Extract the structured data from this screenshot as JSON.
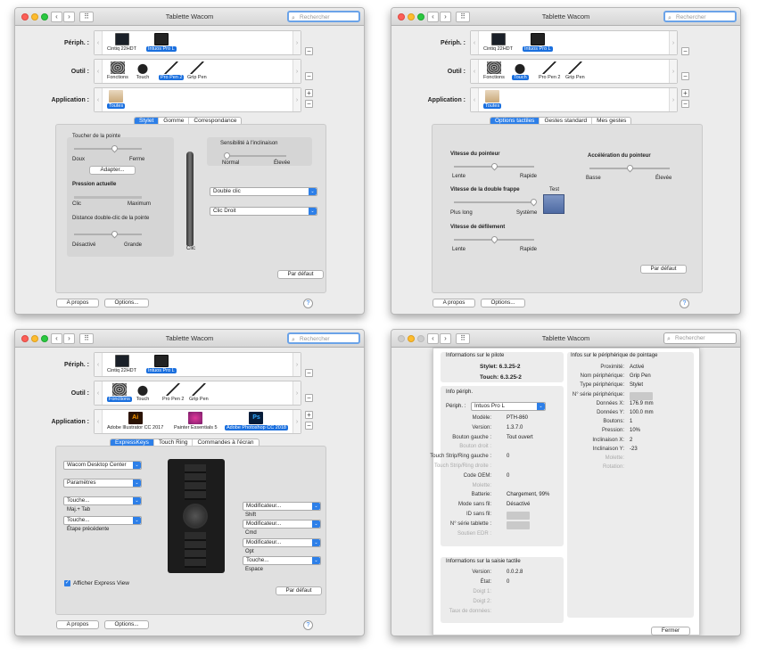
{
  "window_title": "Tablette Wacom",
  "search_placeholder": "Rechercher",
  "labels": {
    "device": "Périph. :",
    "tool": "Outil :",
    "app": "Application :"
  },
  "devices": [
    "Cintiq 22HDT",
    "Intuos Pro L"
  ],
  "common": {
    "about": "A propos",
    "options": "Options...",
    "default": "Par défaut",
    "help": "?",
    "plus": "+",
    "minus": "−",
    "close": "Fermer"
  },
  "w1": {
    "tools": [
      "Fonctions",
      "Touch",
      "Pro Pen 2",
      "Grip Pen"
    ],
    "apps": [
      "Toutes"
    ],
    "tabs": [
      "Stylet",
      "Gomme",
      "Correspondance"
    ],
    "tip_feel": "Toucher de la pointe",
    "soft": "Doux",
    "firm": "Ferme",
    "adjust": "Adapter...",
    "current_pressure": "Pression actuelle",
    "click": "Clic",
    "max": "Maximum",
    "dbl_click_dist": "Distance double-clic de la pointe",
    "disabled": "Désactivé",
    "large": "Grande",
    "tilt": "Sensibilité à l'inclinaison",
    "normal": "Normal",
    "high": "Élevée",
    "btn_upper": "Double clic",
    "btn_lower": "Clic Droit",
    "pen_tip": "Clic"
  },
  "w2": {
    "tools": [
      "Fonctions",
      "Touch",
      "Pro Pen 2",
      "Grip Pen"
    ],
    "apps": [
      "Toutes"
    ],
    "tabs": [
      "Options tactiles",
      "Gestes standard",
      "Mes gestes"
    ],
    "pointer_speed": "Vitesse du pointeur",
    "slow": "Lente",
    "fast": "Rapide",
    "pointer_accel": "Accélération du pointeur",
    "low": "Basse",
    "high": "Élevée",
    "dbl_tap": "Vitesse de la double frappe",
    "longer": "Plus long",
    "system": "Système",
    "test": "Test",
    "scroll": "Vitesse de défilement",
    "slow2": "Lente",
    "fast2": "Rapide"
  },
  "w3": {
    "tools": [
      "Fonctions",
      "Touch",
      "Pro Pen 2",
      "Grip Pen"
    ],
    "apps": [
      "Adobe Illustrator CC 2017",
      "Painter Essentials 5",
      "Adobe Photoshop CC 2018"
    ],
    "tabs": [
      "ExpressKeys",
      "Touch Ring",
      "Commandes à l'écran"
    ],
    "left_keys": [
      {
        "value": "Wacom Desktop Center",
        "sub": ""
      },
      {
        "value": "Paramètres",
        "sub": ""
      },
      {
        "value": "Touche...",
        "sub": "Maj.+ Tab"
      },
      {
        "value": "Touche...",
        "sub": "Étape précédente"
      }
    ],
    "right_keys": [
      {
        "value": "Modificateur...",
        "sub": "Shift"
      },
      {
        "value": "Modificateur...",
        "sub": "Cmd"
      },
      {
        "value": "Modificateur...",
        "sub": "Opt"
      },
      {
        "value": "Touche...",
        "sub": "Espace"
      }
    ],
    "show_express_view": "Afficher Express View"
  },
  "w4": {
    "driver_title": "Informations sur le pilote",
    "stylet": "Stylet: 6.3.25-2",
    "touch": "Touch: 6.3.25-2",
    "device_info": "Info périph.",
    "device_label": "Périph. :",
    "device_value": "Intuos Pro L",
    "device_rows": [
      {
        "k": "Modèle:",
        "v": "PTH-860",
        "dim": false
      },
      {
        "k": "Version:",
        "v": "1.3.7.0",
        "dim": false
      },
      {
        "k": "Bouton gauche :",
        "v": "Tout ouvert",
        "dim": false
      },
      {
        "k": "Bouton droit :",
        "v": "",
        "dim": true
      },
      {
        "k": "Touch Strip/Ring gauche :",
        "v": "0",
        "dim": false
      },
      {
        "k": "Touch Strip/Ring droite :",
        "v": "",
        "dim": true
      },
      {
        "k": "Code OEM:",
        "v": "0",
        "dim": false
      },
      {
        "k": "Molette:",
        "v": "",
        "dim": true
      },
      {
        "k": "Batterie:",
        "v": "Chargement, 99%",
        "dim": false
      },
      {
        "k": "Mode sans fil:",
        "v": "Désactivé",
        "dim": false
      },
      {
        "k": "ID sans fil:",
        "v": "",
        "dim": false,
        "blur": true
      },
      {
        "k": "N° série tablette :",
        "v": "",
        "dim": false,
        "blur": true
      },
      {
        "k": "Soutien EDR :",
        "v": "",
        "dim": true
      }
    ],
    "touch_title": "Informations sur la saisie tactile",
    "touch_rows": [
      {
        "k": "Version:",
        "v": "0.0.2.8",
        "dim": false
      },
      {
        "k": "État:",
        "v": "0",
        "dim": false
      },
      {
        "k": "Doigt 1:",
        "v": "",
        "dim": true
      },
      {
        "k": "Doigt 2:",
        "v": "",
        "dim": true
      },
      {
        "k": "Taux de données:",
        "v": "",
        "dim": true
      }
    ],
    "pointer_title": "Infos sur le périphérique de pointage",
    "pointer_rows": [
      {
        "k": "Proximité:",
        "v": "Activé",
        "dim": false
      },
      {
        "k": "Nom périphérique:",
        "v": "Grip Pen",
        "dim": false
      },
      {
        "k": "Type périphérique:",
        "v": "Stylet",
        "dim": false
      },
      {
        "k": "N° série périphérique:",
        "v": "",
        "dim": false,
        "blur": true
      },
      {
        "k": "Données X:",
        "v": "176.9 mm",
        "dim": false
      },
      {
        "k": "Données Y:",
        "v": "100.0 mm",
        "dim": false
      },
      {
        "k": "Boutons:",
        "v": "1",
        "dim": false
      },
      {
        "k": "Pression:",
        "v": "10%",
        "dim": false
      },
      {
        "k": "Inclinaison X:",
        "v": "2",
        "dim": false
      },
      {
        "k": "Inclinaison Y:",
        "v": "-23",
        "dim": false
      },
      {
        "k": "Molette:",
        "v": "",
        "dim": true
      },
      {
        "k": "Rotation:",
        "v": "",
        "dim": true
      }
    ]
  }
}
